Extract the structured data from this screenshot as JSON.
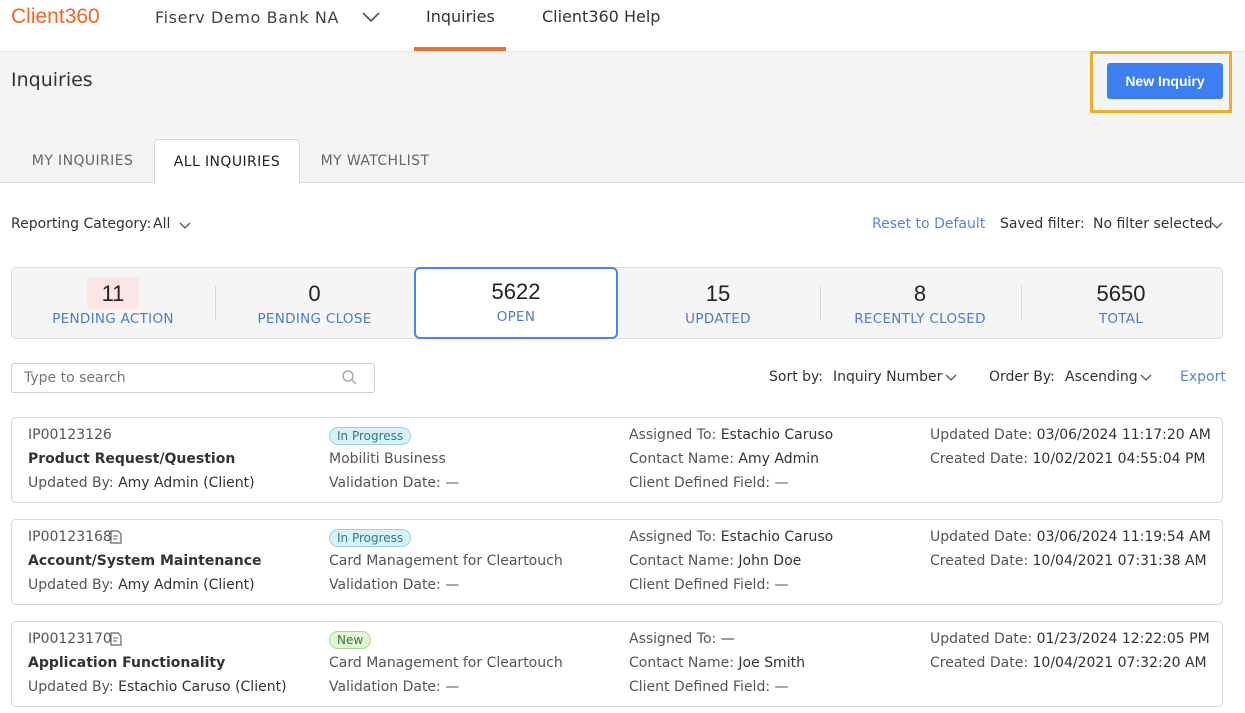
{
  "header": {
    "logo": "Client360",
    "bank": "Fiserv Demo Bank NA",
    "nav": {
      "inquiries": "Inquiries",
      "help": "Client360 Help"
    }
  },
  "page": {
    "title": "Inquiries",
    "new_button": "New Inquiry"
  },
  "tabs": {
    "my": "MY INQUIRIES",
    "all": "ALL INQUIRIES",
    "watch": "MY WATCHLIST"
  },
  "filters": {
    "reporting_label": "Reporting Category:",
    "reporting_value": "All",
    "reset": "Reset to Default",
    "saved_label": "Saved filter:",
    "saved_value": "No filter selected"
  },
  "stats": [
    {
      "num": "11",
      "label": "PENDING ACTION"
    },
    {
      "num": "0",
      "label": "PENDING CLOSE"
    },
    {
      "num": "5622",
      "label": "OPEN"
    },
    {
      "num": "15",
      "label": "UPDATED"
    },
    {
      "num": "8",
      "label": "RECENTLY CLOSED"
    },
    {
      "num": "5650",
      "label": "TOTAL"
    }
  ],
  "search": {
    "placeholder": "Type to search"
  },
  "sort": {
    "sort_label": "Sort by:",
    "sort_value": "Inquiry Number",
    "order_label": "Order By:",
    "order_value": "Ascending",
    "export": "Export"
  },
  "labels": {
    "updated_by": "Updated By:",
    "validation": "Validation Date:",
    "assigned": "Assigned To:",
    "contact": "Contact Name:",
    "client_field": "Client Defined Field:",
    "updated_date": "Updated Date:",
    "created_date": "Created Date:"
  },
  "inquiries": [
    {
      "id": "IP00123126",
      "category": "Product Request/Question",
      "updated_by": "Amy Admin (Client)",
      "status": "In Progress",
      "product": "Mobiliti Business",
      "validation": "—",
      "assigned": "Estachio Caruso",
      "contact": "Amy Admin",
      "client_field": "—",
      "updated_date": "03/06/2024 11:17:20 AM",
      "created_date": "10/02/2021 04:55:04 PM"
    },
    {
      "id": "IP00123168",
      "category": "Account/System Maintenance",
      "updated_by": "Amy Admin (Client)",
      "status": "In Progress",
      "product": "Card Management for Cleartouch",
      "validation": "—",
      "assigned": "Estachio Caruso",
      "contact": "John Doe",
      "client_field": "—",
      "updated_date": "03/06/2024 11:19:54 AM",
      "created_date": "10/04/2021 07:31:38 AM"
    },
    {
      "id": "IP00123170",
      "category": "Application Functionality",
      "updated_by": "Estachio Caruso (Client)",
      "status": "New",
      "product": "Card Management for Cleartouch",
      "validation": "—",
      "assigned": "—",
      "contact": "Joe Smith",
      "client_field": "—",
      "updated_date": "01/23/2024 12:22:05 PM",
      "created_date": "10/04/2021 07:32:20 AM"
    }
  ]
}
